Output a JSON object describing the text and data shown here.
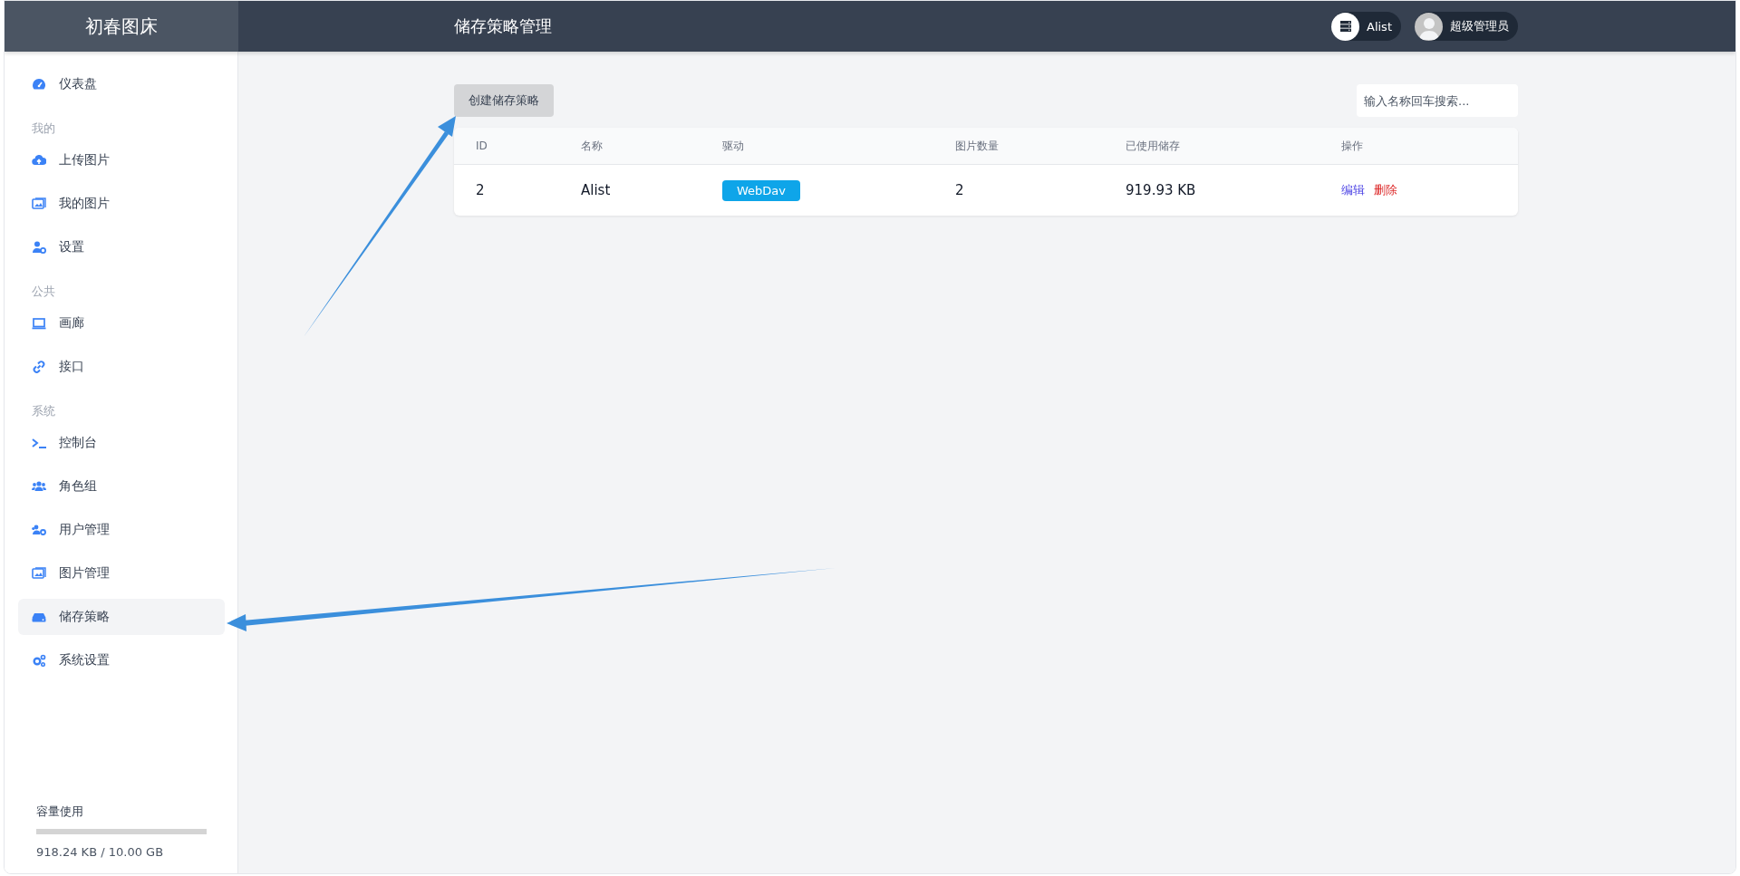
{
  "brand": "初春图床",
  "page_title": "储存策略管理",
  "header_chips": [
    {
      "kind": "storage",
      "label": "Alist"
    },
    {
      "kind": "user",
      "label": "超级管理员"
    }
  ],
  "sidebar": {
    "groups": [
      {
        "items": [
          {
            "label": "仪表盘",
            "selected": false
          }
        ]
      },
      {
        "title": "我的",
        "items": [
          {
            "label": "上传图片",
            "selected": false
          },
          {
            "label": "我的图片",
            "selected": false
          },
          {
            "label": "设置",
            "selected": false
          }
        ]
      },
      {
        "title": "公共",
        "items": [
          {
            "label": "画廊",
            "selected": false
          },
          {
            "label": "接口",
            "selected": false
          }
        ]
      },
      {
        "title": "系统",
        "items": [
          {
            "label": "控制台",
            "selected": false
          },
          {
            "label": "角色组",
            "selected": false
          },
          {
            "label": "用户管理",
            "selected": false
          },
          {
            "label": "图片管理",
            "selected": false
          },
          {
            "label": "储存策略",
            "selected": true
          },
          {
            "label": "系统设置",
            "selected": false
          }
        ]
      }
    ]
  },
  "usage": {
    "title": "容量使用",
    "level": 0.0001,
    "reading": "918.24 KB / 10.00 GB"
  },
  "create_button": "创建储存策略",
  "search": {
    "placeholder": "输入名称回车搜索..."
  },
  "table": {
    "columns": [
      "ID",
      "名称",
      "驱动",
      "图片数量",
      "已使用储存",
      "操作"
    ],
    "rows": [
      {
        "id": "2",
        "name": "Alist",
        "driver": "WebDav",
        "images": "2",
        "used": "919.93 KB",
        "actions": [
          {
            "kind": "edit",
            "label": "编辑"
          },
          {
            "kind": "delete",
            "label": "删除"
          }
        ]
      }
    ]
  }
}
